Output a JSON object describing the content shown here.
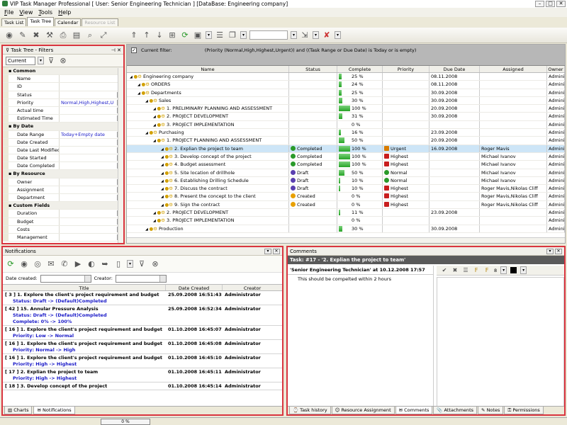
{
  "window": {
    "title": "VIP Task Manager Professional [ User: Senior Engineering Technician ] [DataBase: Engineering company]"
  },
  "menu": [
    "File",
    "View",
    "Tools",
    "Help"
  ],
  "tabs": [
    {
      "label": "Task List",
      "state": "normal"
    },
    {
      "label": "Task Tree",
      "state": "active"
    },
    {
      "label": "Calendar",
      "state": "normal"
    },
    {
      "label": "Resource List",
      "state": "disabled"
    }
  ],
  "filter_panel": {
    "title": "Task Tree - Filters",
    "current": "Current",
    "rows": [
      {
        "type": "cat",
        "name": "Common"
      },
      {
        "type": "prop",
        "name": "Name",
        "value": ""
      },
      {
        "type": "prop",
        "name": "ID",
        "value": ""
      },
      {
        "type": "prop",
        "name": "Status",
        "value": "",
        "dd": true
      },
      {
        "type": "prop",
        "name": "Priority",
        "value": "Normal,High,Highest,U",
        "dd": true
      },
      {
        "type": "prop",
        "name": "Actual time",
        "value": "",
        "dd": true
      },
      {
        "type": "prop",
        "name": "Estimated Time",
        "value": "",
        "dd": true
      },
      {
        "type": "cat",
        "name": "By Date"
      },
      {
        "type": "prop",
        "name": "Date Range",
        "value": "Today+Empty date",
        "dd": true
      },
      {
        "type": "prop",
        "name": "Date Created",
        "value": "",
        "dd": true
      },
      {
        "type": "prop",
        "name": "Date Last Modified",
        "value": "",
        "dd": true
      },
      {
        "type": "prop",
        "name": "Date Started",
        "value": "",
        "dd": true,
        "sel": true
      },
      {
        "type": "prop",
        "name": "Date Completed",
        "value": "",
        "dd": true
      },
      {
        "type": "cat",
        "name": "By Resource"
      },
      {
        "type": "prop",
        "name": "Owner",
        "value": "",
        "dd": true
      },
      {
        "type": "prop",
        "name": "Assignment",
        "value": "",
        "dd": true
      },
      {
        "type": "prop",
        "name": "Department",
        "value": "",
        "dd": true
      },
      {
        "type": "cat",
        "name": "Custom Fields"
      },
      {
        "type": "prop",
        "name": "Duration",
        "value": "",
        "dd": true
      },
      {
        "type": "prop",
        "name": "Budget",
        "value": "",
        "dd": true
      },
      {
        "type": "prop",
        "name": "Costs",
        "value": "",
        "dd": true
      },
      {
        "type": "prop",
        "name": "Management",
        "value": "",
        "dd": true
      }
    ]
  },
  "grid": {
    "current_filter_label": "Current filter:",
    "current_filter_text": "(Priority  (Normal,High,Highest,Urgent)) and ((Task Range or Due Date) is Today or is empty)",
    "columns": [
      "Name",
      "Status",
      "Complete",
      "Priority",
      "Due Date",
      "Assigned",
      "Owner"
    ],
    "rows": [
      {
        "indent": 0,
        "name": "Engineering company",
        "status": "",
        "complete": 25,
        "complete_text": "25 %",
        "priority": "",
        "due": "08.11.2008",
        "assigned": "",
        "owner": "Administr"
      },
      {
        "indent": 1,
        "name": "ORDERS",
        "status": "",
        "complete": 24,
        "complete_text": "24 %",
        "priority": "",
        "due": "08.11.2008",
        "assigned": "",
        "owner": "Administr"
      },
      {
        "indent": 1,
        "name": "Departments",
        "status": "",
        "complete": 25,
        "complete_text": "25 %",
        "priority": "",
        "due": "30.09.2008",
        "assigned": "",
        "owner": "Administr"
      },
      {
        "indent": 2,
        "name": "Sales",
        "status": "",
        "complete": 30,
        "complete_text": "30 %",
        "priority": "",
        "due": "30.09.2008",
        "assigned": "",
        "owner": "Administr"
      },
      {
        "indent": 3,
        "name": "1. PRELIMINARY PLANNING AND ASSESSMENT",
        "status": "",
        "complete": 100,
        "complete_text": "100 %",
        "priority": "",
        "due": "20.09.2008",
        "assigned": "",
        "owner": "Administr"
      },
      {
        "indent": 3,
        "name": "2. PROJECT DEVELOPMENT",
        "status": "",
        "complete": 31,
        "complete_text": "31 %",
        "priority": "",
        "due": "30.09.2008",
        "assigned": "",
        "owner": "Administr"
      },
      {
        "indent": 3,
        "name": "3. PROJECT IMPLEMENTATION",
        "status": "",
        "complete": 0,
        "complete_text": "0 %",
        "priority": "",
        "due": "",
        "assigned": "",
        "owner": "Administr"
      },
      {
        "indent": 2,
        "name": "Purchasing",
        "status": "",
        "complete": 16,
        "complete_text": "16 %",
        "priority": "",
        "due": "23.09.2008",
        "assigned": "",
        "owner": "Administr"
      },
      {
        "indent": 3,
        "name": "1. PROJECT PLANNING AND ASSESSMENT",
        "status": "",
        "complete": 50,
        "complete_text": "50 %",
        "priority": "",
        "due": "20.09.2008",
        "assigned": "",
        "owner": "Administr"
      },
      {
        "indent": 4,
        "name": "2. Explian the project to team",
        "status": "Completed",
        "complete": 100,
        "complete_text": "100 %",
        "priority": "Urgent",
        "due": "16.09.2008",
        "assigned": "Roger Mavis",
        "owner": "Administr",
        "highlight": true
      },
      {
        "indent": 4,
        "name": "3. Develop concept of the project",
        "status": "Completed",
        "complete": 100,
        "complete_text": "100 %",
        "priority": "Highest",
        "due": "",
        "assigned": "Michael Ivanov",
        "owner": "Administr"
      },
      {
        "indent": 4,
        "name": "4. Budget assessment",
        "status": "Completed",
        "complete": 100,
        "complete_text": "100 %",
        "priority": "Highest",
        "due": "",
        "assigned": "Michael Ivanov",
        "owner": "Administr"
      },
      {
        "indent": 4,
        "name": "5. Site location of drillhole",
        "status": "Draft",
        "complete": 50,
        "complete_text": "50 %",
        "priority": "Normal",
        "due": "",
        "assigned": "Michael Ivanov",
        "owner": "Administr"
      },
      {
        "indent": 4,
        "name": "6. Establishing Drilling Schedule",
        "status": "Draft",
        "complete": 10,
        "complete_text": "10 %",
        "priority": "Normal",
        "due": "",
        "assigned": "Michael Ivanov",
        "owner": "Administr"
      },
      {
        "indent": 4,
        "name": "7. Discuss the contract",
        "status": "Draft",
        "complete": 10,
        "complete_text": "10 %",
        "priority": "Highest",
        "due": "",
        "assigned": "Roger Mavis,Nikolas Cliff",
        "owner": "Administr"
      },
      {
        "indent": 4,
        "name": "8. Present the concept to the client",
        "status": "Created",
        "complete": 0,
        "complete_text": "0 %",
        "priority": "Highest",
        "due": "",
        "assigned": "Roger Mavis,Nikolas Cliff",
        "owner": "Administr"
      },
      {
        "indent": 4,
        "name": "9. Sign the contract",
        "status": "Created",
        "complete": 0,
        "complete_text": "0 %",
        "priority": "Highest",
        "due": "",
        "assigned": "Roger Mavis,Nikolas Cliff",
        "owner": "Administr"
      },
      {
        "indent": 3,
        "name": "2. PROJECT DEVELOPMENT",
        "status": "",
        "complete": 11,
        "complete_text": "11 %",
        "priority": "",
        "due": "23.09.2008",
        "assigned": "",
        "owner": "Administr"
      },
      {
        "indent": 3,
        "name": "3. PROJECT IMPLEMENTATION",
        "status": "",
        "complete": 0,
        "complete_text": "0 %",
        "priority": "",
        "due": "",
        "assigned": "",
        "owner": "Administr"
      },
      {
        "indent": 2,
        "name": "Production",
        "status": "",
        "complete": 30,
        "complete_text": "30 %",
        "priority": "",
        "due": "30.09.2008",
        "assigned": "",
        "owner": "Administr"
      }
    ]
  },
  "notifications": {
    "title": "Notifications",
    "date_created_label": "Date created:",
    "creator_label": "Creator:",
    "columns": [
      "Title",
      "Date Created",
      "Creator"
    ],
    "items": [
      {
        "title": "[ 3 ] 1. Explore the client's project requirement and budget",
        "date": "25.09.2008 16:51:43",
        "creator": "Administrator",
        "details": [
          "Status: Draft -> (Default)Completed"
        ]
      },
      {
        "title": "[ 42 ] 15. Annular Pressure Analysis",
        "date": "25.09.2008 16:52:34",
        "creator": "Administrator",
        "details": [
          "Status: Draft -> (Default)Completed",
          "Complete: 0% -> 100%"
        ]
      },
      {
        "title": "[ 16 ] 1. Explore the client's project requirement and budget",
        "date": "01.10.2008 16:45:07",
        "creator": "Administrator",
        "details": [
          "Priority: Low -> Normal"
        ]
      },
      {
        "title": "[ 16 ] 1. Explore the client's project requirement and budget",
        "date": "01.10.2008 16:45:08",
        "creator": "Administrator",
        "details": [
          "Priority: Normal -> High"
        ]
      },
      {
        "title": "[ 16 ] 1. Explore the client's project requirement and budget",
        "date": "01.10.2008 16:45:10",
        "creator": "Administrator",
        "details": [
          "Priority: High -> Highest"
        ]
      },
      {
        "title": "[ 17 ] 2. Explian the project to team",
        "date": "01.10.2008 16:45:11",
        "creator": "Administrator",
        "details": [
          "Priority: High -> Highest"
        ]
      },
      {
        "title": "[ 18 ] 3. Develop concept of the project",
        "date": "01.10.2008 16:45:14",
        "creator": "Administrator",
        "details": []
      }
    ],
    "bottom_tabs": [
      "Charts",
      "Notifications"
    ]
  },
  "comments": {
    "title": "Comments",
    "task": "Task: #17 - '2. Explian the project to team'",
    "meta": "'Senior Engineering Technician' at 10.12.2008 17:57",
    "text": "This should be compelted within 2 hours",
    "font_size": "8",
    "tabs": [
      "Task history",
      "Resource Assignment",
      "Comments",
      "Attachments",
      "Notes",
      "Permissions"
    ],
    "active_tab": "Comments"
  },
  "statusbar": {
    "progress_text": "0 %"
  },
  "colors": {
    "accent_red": "#d9353f",
    "progress_green": "#27a327",
    "highlight_row": "#cde5f7"
  }
}
